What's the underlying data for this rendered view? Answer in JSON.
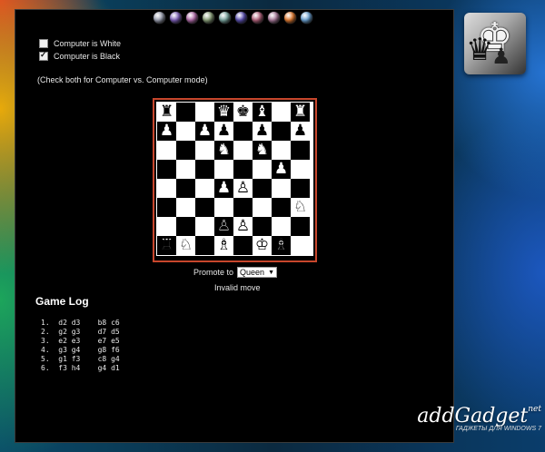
{
  "orbs": [
    "#9a9fb0",
    "#7d5fb8",
    "#b06ba8",
    "#8aa07a",
    "#7aa6a0",
    "#5a4fb0",
    "#b0607a",
    "#a87a9a",
    "#e07a30",
    "#6aa0d0"
  ],
  "options": {
    "computer_white_label": "Computer is White",
    "computer_white_checked": false,
    "computer_black_label": "Computer is Black",
    "computer_black_checked": true,
    "mode_note": "(Check both for Computer vs. Computer mode)"
  },
  "board": [
    [
      "bR",
      "",
      "",
      "bQ",
      "bK",
      "bB",
      "",
      "bR"
    ],
    [
      "bP",
      "",
      "bP",
      "bP",
      "",
      "bP",
      "",
      "bP"
    ],
    [
      "",
      "",
      "",
      "bN",
      "",
      "bN",
      "",
      ""
    ],
    [
      "",
      "",
      "",
      "",
      "",
      "",
      "bP",
      ""
    ],
    [
      "",
      "",
      "",
      "bP",
      "wP",
      "",
      "",
      ""
    ],
    [
      "",
      "",
      "",
      "",
      "",
      "",
      "",
      "wN"
    ],
    [
      "",
      "",
      "",
      "wP",
      "wP",
      "",
      "",
      ""
    ],
    [
      "wP",
      "wP",
      "",
      "",
      "",
      "",
      "",
      ""
    ]
  ],
  "back_rank": [
    "wR",
    "wN",
    "",
    "wB",
    "",
    "wK",
    "wB",
    ""
  ],
  "promotion": {
    "label": "Promote to",
    "selected": "Queen"
  },
  "status": "Invalid move",
  "game_log": {
    "title": "Game Log",
    "moves": [
      "1.  d2 d3    b8 c6",
      "2.  g2 g3    d7 d5",
      "3.  e2 e3    e7 e5",
      "4.  g3 g4    g8 f6",
      "5.  g1 f3    c8 g4",
      "6.  f3 h4    g4 d1"
    ]
  },
  "watermark": {
    "main": "addGadget",
    "sup": "net",
    "sub": "ГАДЖЕТЫ ДЛЯ WINDOWS 7"
  }
}
